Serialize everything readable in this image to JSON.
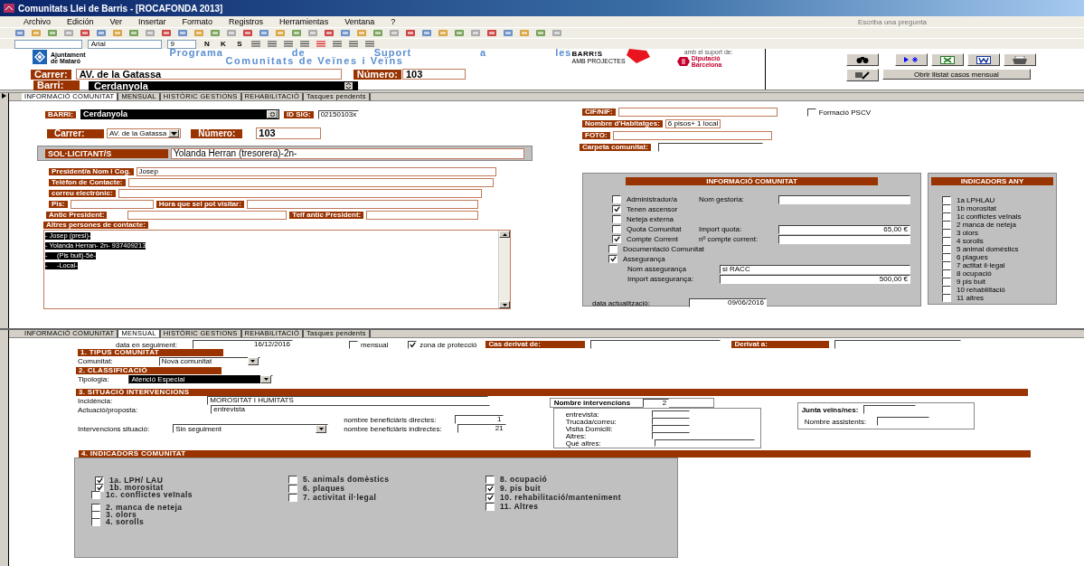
{
  "window": {
    "title": "Comunitats Llei de Barris - [ROCAFONDA 2013]"
  },
  "menu": [
    "Archivo",
    "Edición",
    "Ver",
    "Insertar",
    "Formato",
    "Registros",
    "Herramientas",
    "Ventana",
    "?"
  ],
  "help_box": {
    "placeholder": "Escriba una pregunta"
  },
  "format_bar": {
    "font": "Arial",
    "size": "9",
    "style_buttons": [
      "N",
      "K",
      "S"
    ]
  },
  "header": {
    "city_logo": [
      "Ajuntament",
      "de Mataró"
    ],
    "title_words": [
      "Programa",
      "de",
      "Suport",
      "a",
      "les"
    ],
    "subtitle": "Comunitats de Veïnes i Veïns",
    "barris_logo": {
      "name": "BARR!S",
      "tagline": "AMB PROJECTES"
    },
    "support_note": "amb el suport de:",
    "diputacio_logo": [
      "Diputació",
      "Barcelona"
    ],
    "carrer": {
      "label": "Carrer:",
      "value": "AV. de la Gatassa"
    },
    "numero": {
      "label": "Número:",
      "value": "103"
    },
    "barri": {
      "label": "Barri:",
      "value": "Cerdanyola"
    },
    "list_button": "Obrir llistat casos mensual"
  },
  "form_1": {
    "tabs": [
      {
        "label": "INFORMACIÓ COMUNITAT",
        "selected": true
      },
      {
        "label": "MENSUAL",
        "selected": false
      },
      {
        "label": "HISTÒRIC GESTIONS",
        "selected": false
      },
      {
        "label": "REHABILITACIÓ",
        "selected": false
      },
      {
        "label": "Tasques pendents",
        "selected": false
      }
    ],
    "barri": {
      "label": "BARRI:",
      "value": "Cerdanyola"
    },
    "id_sig": {
      "label": "ID SIG:",
      "value": "02150103x"
    },
    "carrer": {
      "label": "Carrer:",
      "value": "AV. de la Gatassa"
    },
    "numero": {
      "label": "Número:",
      "value": "103"
    },
    "sollicitant": {
      "label": "SOL·LICITANT/S",
      "value": "Yolanda Herran (tresorera)-2n-"
    },
    "president": {
      "label": "President/a  Nom i Cog.",
      "value": "Josep"
    },
    "telefon": {
      "label": "Telèfon de Contacte:"
    },
    "correu": {
      "label": "correu electrònic:"
    },
    "pis": {
      "label": "Pis:"
    },
    "hora": {
      "label": "Hora que sel pot visitar:"
    },
    "antic": {
      "label": "Antic President:"
    },
    "telf_antic": {
      "label": "Telf antic President:"
    },
    "altres": {
      "label": "Altres persones de contacte:",
      "highlighted": true,
      "lines": [
        "- Josep (presi)-",
        "- Yolanda Herran- 2n- 937409213",
        "-     (Pis buit)-5è-",
        "-     -Local-"
      ]
    },
    "cif": {
      "label": "CIF/NIF:"
    },
    "habitatges": {
      "label": "Nombre d'Habitatges:",
      "value": "6 pisos+ 1 local"
    },
    "foto": {
      "label": "FOTO:"
    },
    "carpeta": {
      "label": "Carpeta comunitat:"
    },
    "formacio": {
      "label": "Formació PSCV",
      "checked": false
    },
    "info": {
      "title": "INFORMACIÓ COMUNITAT",
      "rows": [
        {
          "kind": "check",
          "label": "Administrador/a",
          "checked": false,
          "field_label": "Nom gestoria:"
        },
        {
          "kind": "check",
          "label": "Tenen ascensor",
          "checked": true
        },
        {
          "kind": "check",
          "label": "Neteja externa",
          "checked": false
        },
        {
          "kind": "check",
          "label": "Quota Comunitat",
          "checked": false,
          "field_label": "Import quota:",
          "value": "65,00 €"
        },
        {
          "kind": "check",
          "label": "Compte Corrent",
          "checked": true,
          "field_label": "nº compte corrent:"
        },
        {
          "kind": "check",
          "label": "Documentació Comunitat",
          "checked": false
        },
        {
          "kind": "check",
          "label": "Assegurança",
          "checked": true
        },
        {
          "kind": "field",
          "label": "Nom assegurança",
          "value": "si RACC"
        },
        {
          "kind": "field",
          "label": "Import assegurança:",
          "value": "500,00 €"
        }
      ],
      "date": {
        "label": "data actualització:",
        "value": "09/06/2016"
      }
    },
    "indicators": {
      "title": "INDICADORS ANY",
      "items": [
        {
          "label": "1a  LPHLAU",
          "checked": false
        },
        {
          "label": "1b morositat",
          "checked": false
        },
        {
          "label": "1c conflictes veïnals",
          "checked": false
        },
        {
          "label": "2 manca de neteja",
          "checked": false
        },
        {
          "label": "3 olors",
          "checked": false
        },
        {
          "label": "4 sorolls",
          "checked": false
        },
        {
          "label": "5 animal domèstics",
          "checked": false
        },
        {
          "label": "6 plagues",
          "checked": false
        },
        {
          "label": "7 actitat il·legal",
          "checked": false
        },
        {
          "label": "8 ocupació",
          "checked": false
        },
        {
          "label": "9 pis buit",
          "checked": false
        },
        {
          "label": "10 rehabilitació",
          "checked": false
        },
        {
          "label": "11 altres",
          "checked": false
        }
      ]
    }
  },
  "form_2": {
    "tabs": [
      {
        "label": "INFORMACIÓ COMUNITAT",
        "selected": false
      },
      {
        "label": "MENSUAL",
        "selected": true
      },
      {
        "label": "HISTÒRIC GESTIONS",
        "selected": false
      },
      {
        "label": "REHABILITACIÓ",
        "selected": false
      },
      {
        "label": "Tasques pendents",
        "selected": false
      }
    ],
    "data_seguiment": {
      "label": "data en seguiment:",
      "value": "16/12/2016"
    },
    "mensual": {
      "label": "mensual",
      "checked": false
    },
    "zona": {
      "label": "zona de protecció",
      "checked": true
    },
    "cas_derivat": {
      "label": "Cas derivat de:"
    },
    "derivat_a": {
      "label": "Derivat a:"
    },
    "section_1": "1. TIPUS COMUNITAT",
    "comunitat": {
      "label": "Comunitat:",
      "value": "Nova comunitat"
    },
    "section_2": "2. CLASSIFICACIÓ",
    "tipologia": {
      "label": "Tipologia:",
      "value": "Atenció Especial"
    },
    "section_3": "3.  SITUACIÓ INTERVENCIONS",
    "incidencia": {
      "label": "Incidència:",
      "value": "MOROSITAT I HUMITATS"
    },
    "actuacio": {
      "label": "Actuació/proposta:",
      "value": "entrevista"
    },
    "situacio": {
      "label": "Intervencions situació:",
      "value": "Sin seguiment"
    },
    "directes": {
      "label": "nombre beneficiàris directes:",
      "value": "1"
    },
    "indirectes": {
      "label": "nombre beneficiàris indirectes:",
      "value": "21"
    },
    "intervencions": {
      "label": "Nombre intervencions",
      "value": "2",
      "items": [
        "entrevista:",
        "Trucada/correu:",
        "Visita Domicili:",
        "Altres:",
        "Què altres:"
      ]
    },
    "junta": {
      "label": "Junta veïns/nes:"
    },
    "assistents": {
      "label": "Nombre assistents:"
    },
    "section_4": "4. INDICADORS COMUNITAT",
    "indicator_columns": [
      {
        "items": [
          {
            "label": "1a. LPH/ LAU",
            "checked": true
          },
          {
            "label": "1b. morositat",
            "checked": true
          },
          {
            "label": "1c. conflictes veïnals",
            "checked": false
          },
          {
            "label": "2. manca de neteja",
            "checked": false
          },
          {
            "label": "3. olors",
            "checked": false
          },
          {
            "label": "4. sorolls",
            "checked": false
          }
        ]
      },
      {
        "items": [
          {
            "label": "5. animals domèstics",
            "checked": false
          },
          {
            "label": "6. plaques",
            "checked": false
          },
          {
            "label": "7. activitat  il·legal",
            "checked": false
          }
        ]
      },
      {
        "items": [
          {
            "label": "8. ocupació",
            "checked": false
          },
          {
            "label": "9. pis buit",
            "checked": true
          },
          {
            "label": "10. rehabilitació/manteniment",
            "checked": true
          },
          {
            "label": "11. Altres",
            "checked": false
          }
        ]
      }
    ]
  }
}
